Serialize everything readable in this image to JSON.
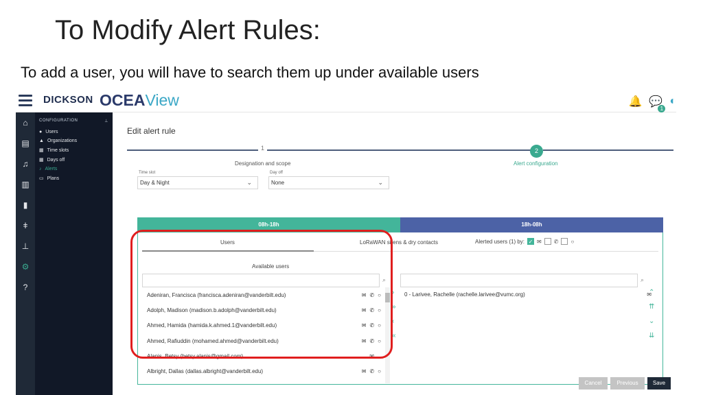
{
  "slide": {
    "title": "To Modify Alert Rules:",
    "subtitle": "To add a user, you will have to search them up under available users"
  },
  "app": {
    "brand_left": "DICKSON",
    "brand_ocea": "OCEA",
    "brand_view": "View",
    "notif_badge": "1"
  },
  "sidenav": {
    "section": "CONFIGURATION",
    "items": [
      {
        "label": "Users",
        "icon": "user-icon"
      },
      {
        "label": "Organizations",
        "icon": "org-icon"
      },
      {
        "label": "Time slots",
        "icon": "calendar-icon"
      },
      {
        "label": "Days off",
        "icon": "calendar-icon"
      },
      {
        "label": "Alerts",
        "icon": "bell-icon",
        "active": true
      },
      {
        "label": "Plans",
        "icon": "map-icon"
      }
    ]
  },
  "form": {
    "title": "Edit alert rule",
    "step1_num": "1",
    "step1_label": "Designation and scope",
    "step2_num": "2",
    "step2_label": "Alert configuration",
    "timeslot_label": "Time slot",
    "timeslot_value": "Day & Night",
    "dayoff_label": "Day off",
    "dayoff_value": "None",
    "tab_green": "08h-18h",
    "tab_blue": "18h-08h",
    "subtab_users": "Users",
    "subtab_lora": "LoRaWAN sirens & dry contacts",
    "available_title": "Available users",
    "alerted_title": "Alerted users (1) by:",
    "users": [
      {
        "name": "Adeniran, Francisca (francisca.adeniran@vanderbilt.edu)",
        "mail": "✉",
        "phone": "✆",
        "chat": "○"
      },
      {
        "name": "Adolph, Madison (madison.b.adolph@vanderbilt.edu)",
        "mail": "✉",
        "phone": "✆",
        "chat": "○"
      },
      {
        "name": "Ahmed, Hamida (hamida.k.ahmed.1@vanderbilt.edu)",
        "mail": "✉",
        "phone": "✆",
        "chat": "○"
      },
      {
        "name": "Ahmed, Rafiuddin (mohamed.ahmed@vanderbilt.edu)",
        "mail": "✉",
        "phone": "✆",
        "chat": "○"
      },
      {
        "name": "Alanis, Betsy (betsy.alanis@gmail.com)",
        "mail": "✉",
        "phone": "",
        "chat": ""
      },
      {
        "name": "Albright, Dallas (dallas.albright@vanderbilt.edu)",
        "mail": "✉",
        "phone": "✆",
        "chat": "○"
      }
    ],
    "alerted": [
      {
        "name": "0 - Larivee, Rachelle (rachelle.larivee@vumc.org)",
        "mail": "✉"
      }
    ],
    "cancel": "Cancel",
    "previous": "Previous",
    "save": "Save"
  }
}
